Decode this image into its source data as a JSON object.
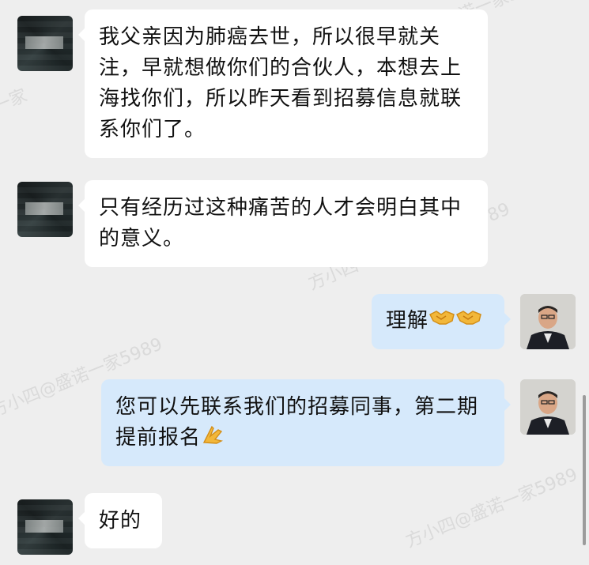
{
  "messages": [
    {
      "side": "left",
      "text": "我父亲因为肺癌去世，所以很早就关注，早就想做你们的合伙人，本想去上海找你们，所以昨天看到招募信息就联系你们了。"
    },
    {
      "side": "left",
      "text": "只有经历过这种痛苦的人才会明白其中的意义。"
    },
    {
      "side": "right",
      "text": "理解",
      "emoji": [
        "handshake-emoji",
        "handshake-emoji"
      ]
    },
    {
      "side": "right",
      "text": "您可以先联系我们的招募同事，第二期提前报名",
      "emoji": [
        "folded-hands-emoji"
      ]
    },
    {
      "side": "left",
      "text": "好的"
    }
  ],
  "watermark": {
    "text_a": "方小四@盛诺一家5989",
    "text_b": "一家",
    "text_c": "5989",
    "text_d": "方小四"
  },
  "colors": {
    "background": "#eeeeee",
    "left_bubble": "#ffffff",
    "right_bubble": "#d6e9fb"
  }
}
